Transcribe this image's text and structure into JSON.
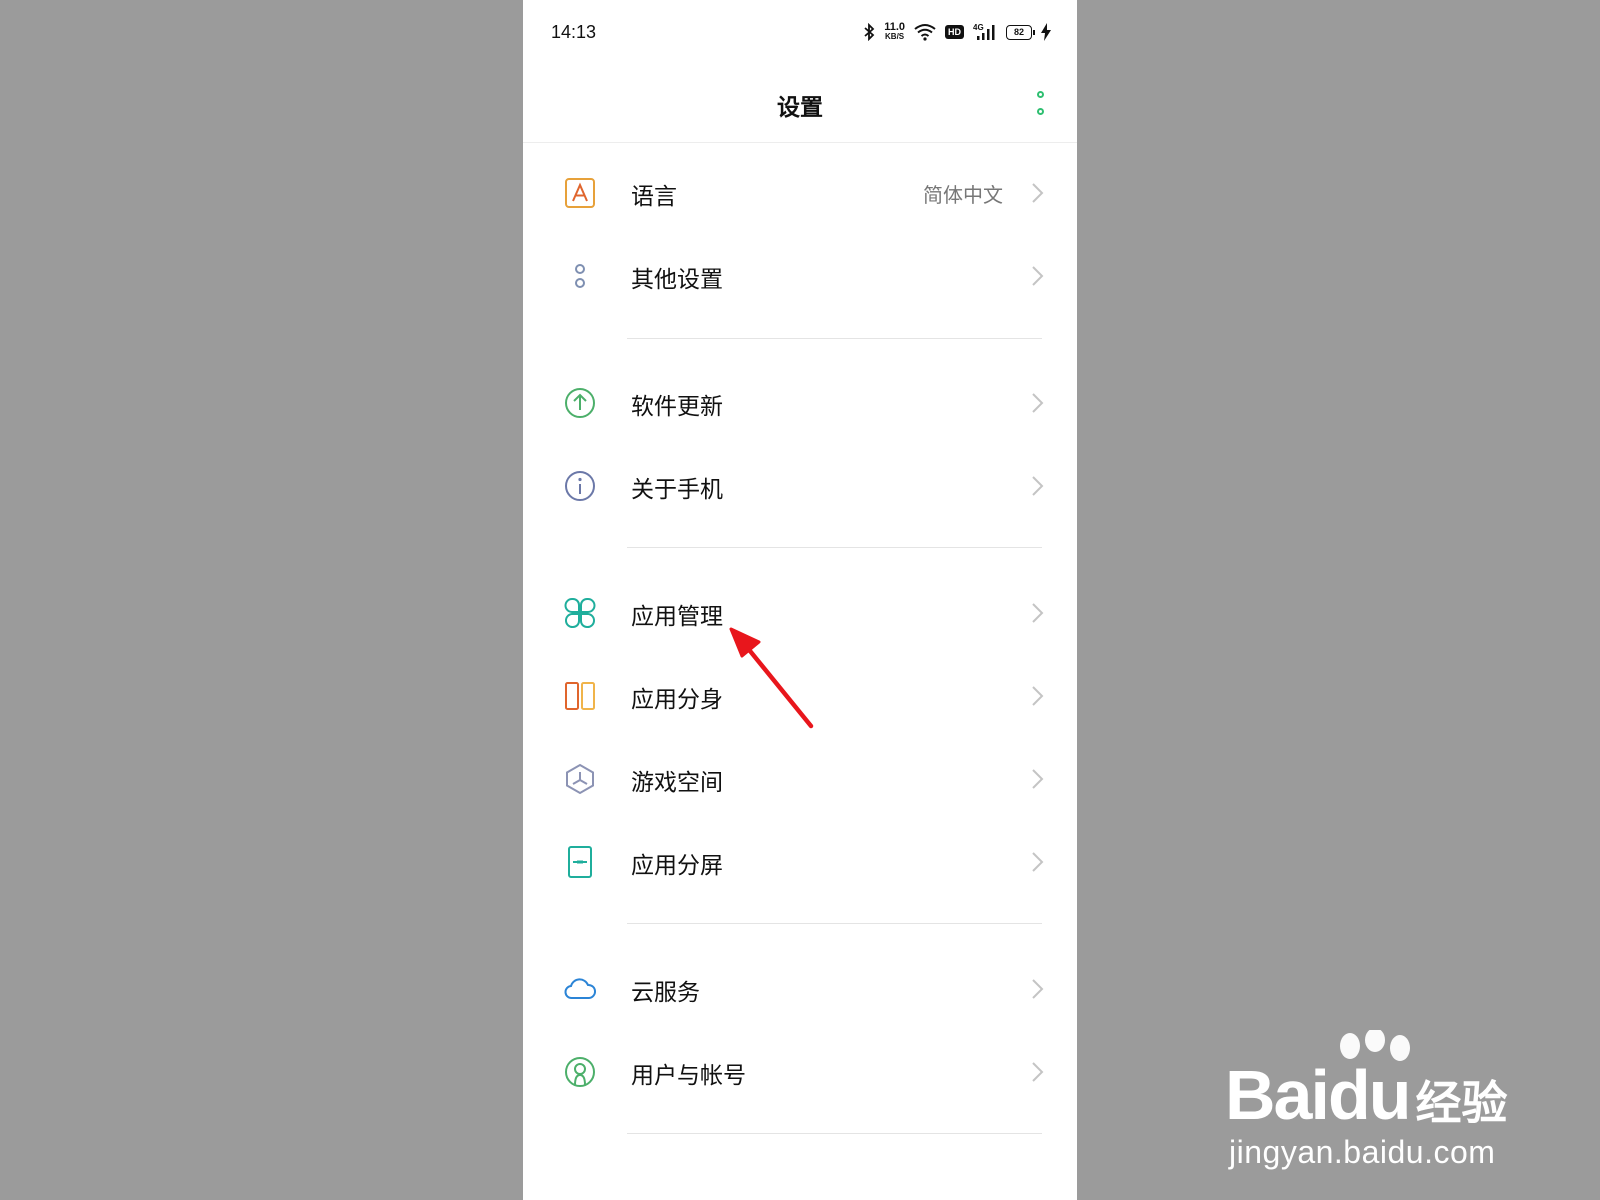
{
  "status_bar": {
    "time": "14:13",
    "speed_value": "11.0",
    "speed_unit": "KB/S",
    "hd": "HD",
    "network": "4G",
    "battery": "82"
  },
  "header": {
    "title": "设置"
  },
  "settings": [
    {
      "label": "语言",
      "value": "简体中文",
      "icon": "language-icon",
      "color": "#e7a13a"
    },
    {
      "label": "其他设置",
      "icon": "other-settings-icon",
      "color": "#7e8fb1"
    },
    {
      "label": "软件更新",
      "icon": "software-update-icon",
      "color": "#4caf6a"
    },
    {
      "label": "关于手机",
      "icon": "info-icon",
      "color": "#6b78a8"
    },
    {
      "label": "应用管理",
      "icon": "app-management-icon",
      "color": "#1fae9c"
    },
    {
      "label": "应用分身",
      "icon": "app-clone-icon",
      "color": "#e0652d"
    },
    {
      "label": "游戏空间",
      "icon": "game-space-icon",
      "color": "#8c93b4"
    },
    {
      "label": "应用分屏",
      "icon": "split-screen-icon",
      "color": "#1fae9c"
    },
    {
      "label": "云服务",
      "icon": "cloud-icon",
      "color": "#2b84d6"
    },
    {
      "label": "用户与帐号",
      "icon": "user-account-icon",
      "color": "#4caf6a"
    }
  ],
  "watermark": {
    "brand": "Bai",
    "brand_du": "du",
    "brand_cn": "经验",
    "url": "jingyan.baidu.com"
  },
  "colors": {
    "accent": "#2fbf71",
    "annotation": "#e8161c",
    "background": "#9b9b9b"
  }
}
